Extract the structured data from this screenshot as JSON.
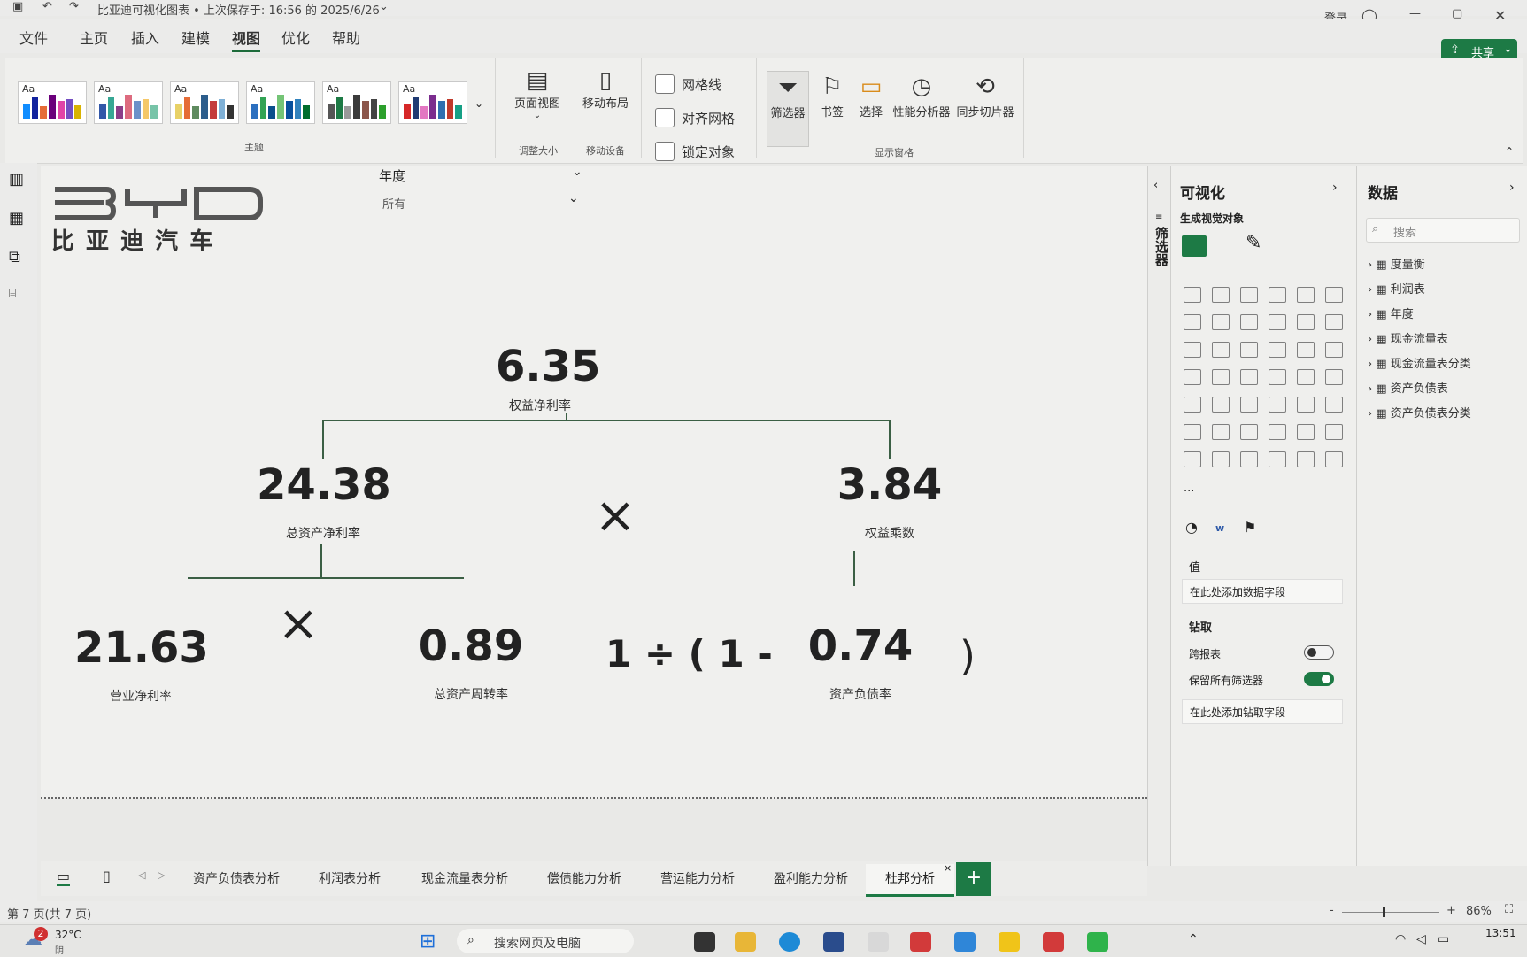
{
  "window": {
    "title": "比亚迪可视化图表 • 上次保存于: 16:56 的 2025/6/26",
    "login": "登录",
    "share": "共享"
  },
  "menu": {
    "items": [
      "文件",
      "主页",
      "插入",
      "建模",
      "视图",
      "优化",
      "帮助"
    ],
    "active": "视图"
  },
  "ribbon": {
    "themes_label": "主题",
    "theme_thumb_text": "Aa",
    "page_view": "页面视图",
    "adjust_size": "调整大小",
    "mobile_layout": "移动布局",
    "mobile_device": "移动设备",
    "gridlines": "网格线",
    "snap_grid": "对齐网格",
    "lock_objects": "锁定对象",
    "filter": "筛选器",
    "bookmark": "书签",
    "select": "选择",
    "perf_analyzer": "性能分析器",
    "sync_slicers": "同步切片器",
    "show_panes": "显示窗格"
  },
  "canvas": {
    "logo_letters": "BYD",
    "logo_text": "比 亚 迪 汽 车",
    "slicer_title": "年度",
    "slicer_value": "所有",
    "roe_value": "6.35",
    "roe_label": "权益净利率",
    "roa_value": "24.38",
    "roa_label": "总资产净利率",
    "multiply_1": "×",
    "equity_mult_value": "3.84",
    "equity_mult_label": "权益乘数",
    "net_margin_value": "21.63",
    "net_margin_label": "营业净利率",
    "multiply_2": "×",
    "asset_turnover_value": "0.89",
    "asset_turnover_label": "总资产周转率",
    "formula_prefix": "1 ÷ ( 1 -",
    "debt_ratio_value": "0.74",
    "debt_ratio_label": "资产负债率",
    "formula_suffix": ")"
  },
  "filter_pane": {
    "label": "筛选器"
  },
  "viz_pane": {
    "title": "可视化",
    "build_visual": "生成视觉对象",
    "more": "...",
    "values_label": "值",
    "add_data_field": "在此处添加数据字段",
    "drill_label": "钻取",
    "cross_report": "跨报表",
    "keep_filters": "保留所有筛选器",
    "add_drill_field": "在此处添加钻取字段",
    "cross_report_on": false,
    "keep_filters_on": true
  },
  "data_pane": {
    "title": "数据",
    "search_placeholder": "搜索",
    "fields": [
      "度量衡",
      "利润表",
      "年度",
      "现金流量表",
      "现金流量表分类",
      "资产负债表",
      "资产负债表分类"
    ]
  },
  "tabs": {
    "items": [
      "资产负债表分析",
      "利润表分析",
      "现金流量表分析",
      "偿债能力分析",
      "营运能力分析",
      "盈利能力分析",
      "杜邦分析"
    ],
    "active": "杜邦分析",
    "add": "+",
    "close": "×"
  },
  "status": {
    "page": "第 7 页(共 7 页)",
    "zoom": "86%",
    "zoom_minus": "-",
    "zoom_plus": "+"
  },
  "taskbar": {
    "weather_temp": "32°C",
    "weather_desc": "阴",
    "notif_count": "2",
    "search": "搜索网页及电脑",
    "time": "13:51"
  },
  "colors": {
    "accent": "#1d7a45",
    "line": "#3b5f44"
  }
}
